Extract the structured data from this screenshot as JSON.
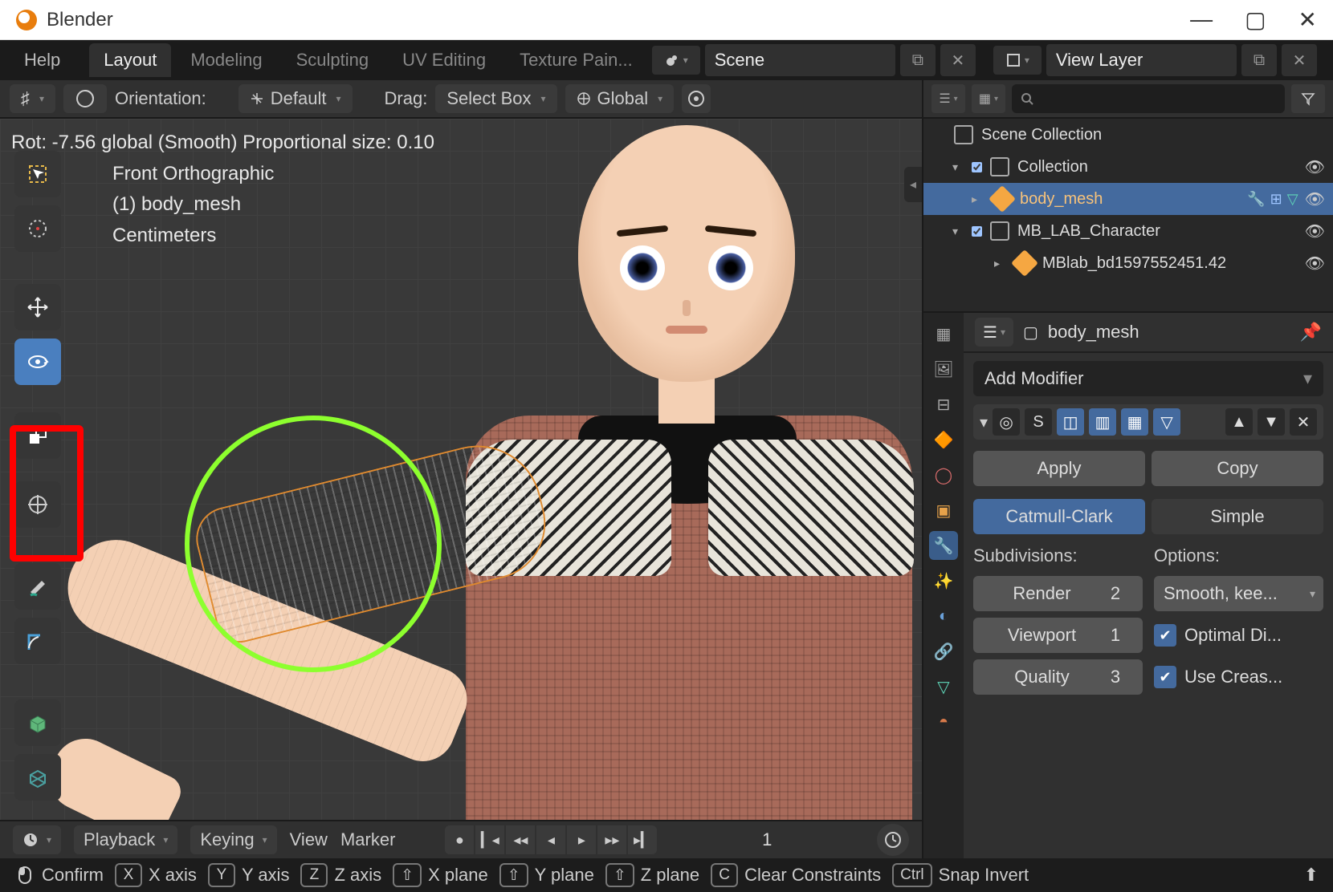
{
  "title": "Blender",
  "workspace": {
    "help": "Help",
    "tabs": [
      "Layout",
      "Modeling",
      "Sculpting",
      "UV Editing",
      "Texture Pain..."
    ],
    "active_tab": 0,
    "scene_label": "Scene",
    "viewlayer_label": "View Layer"
  },
  "viewport_header": {
    "orientation_label": "Orientation:",
    "orientation_value": "Default",
    "drag_label": "Drag:",
    "drag_value": "Select Box",
    "transform_value": "Global"
  },
  "viewport": {
    "op_status": "Rot: -7.56 global (Smooth) Proportional size: 0.10",
    "view_name": "Front Orthographic",
    "active_obj": "(1) body_mesh",
    "units": "Centimeters"
  },
  "timeline": {
    "playback": "Playback",
    "keying": "Keying",
    "view": "View",
    "marker": "Marker",
    "frame": "1"
  },
  "hints": [
    {
      "mouse": "left",
      "label": "Confirm"
    },
    {
      "key": "X",
      "label": "X axis"
    },
    {
      "key": "Y",
      "label": "Y axis"
    },
    {
      "key": "Z",
      "label": "Z axis"
    },
    {
      "key": "⇧",
      "label": "X plane"
    },
    {
      "key": "⇧",
      "label": "Y plane"
    },
    {
      "key": "⇧",
      "label": "Z plane"
    },
    {
      "key": "C",
      "label": "Clear Constraints"
    },
    {
      "key": "Ctrl",
      "label": "Snap Invert"
    }
  ],
  "outliner": {
    "root": "Scene Collection",
    "items": [
      {
        "name": "Collection"
      },
      {
        "name": "body_mesh",
        "selected": true
      },
      {
        "name": "MB_LAB_Character"
      },
      {
        "name": "MBlab_bd1597552451.42"
      }
    ]
  },
  "properties": {
    "breadcrumb": "body_mesh",
    "add_modifier": "Add Modifier",
    "modifier_letter": "S",
    "apply": "Apply",
    "copy": "Copy",
    "subdiv_type": {
      "a": "Catmull-Clark",
      "b": "Simple"
    },
    "subdivisions_label": "Subdivisions:",
    "options_label": "Options:",
    "rows": {
      "render": "Render",
      "render_v": "2",
      "viewport": "Viewport",
      "viewport_v": "1",
      "quality": "Quality",
      "quality_v": "3"
    },
    "smooth_option": "Smooth, kee...",
    "optimal": "Optimal Di...",
    "creases": "Use Creas..."
  }
}
